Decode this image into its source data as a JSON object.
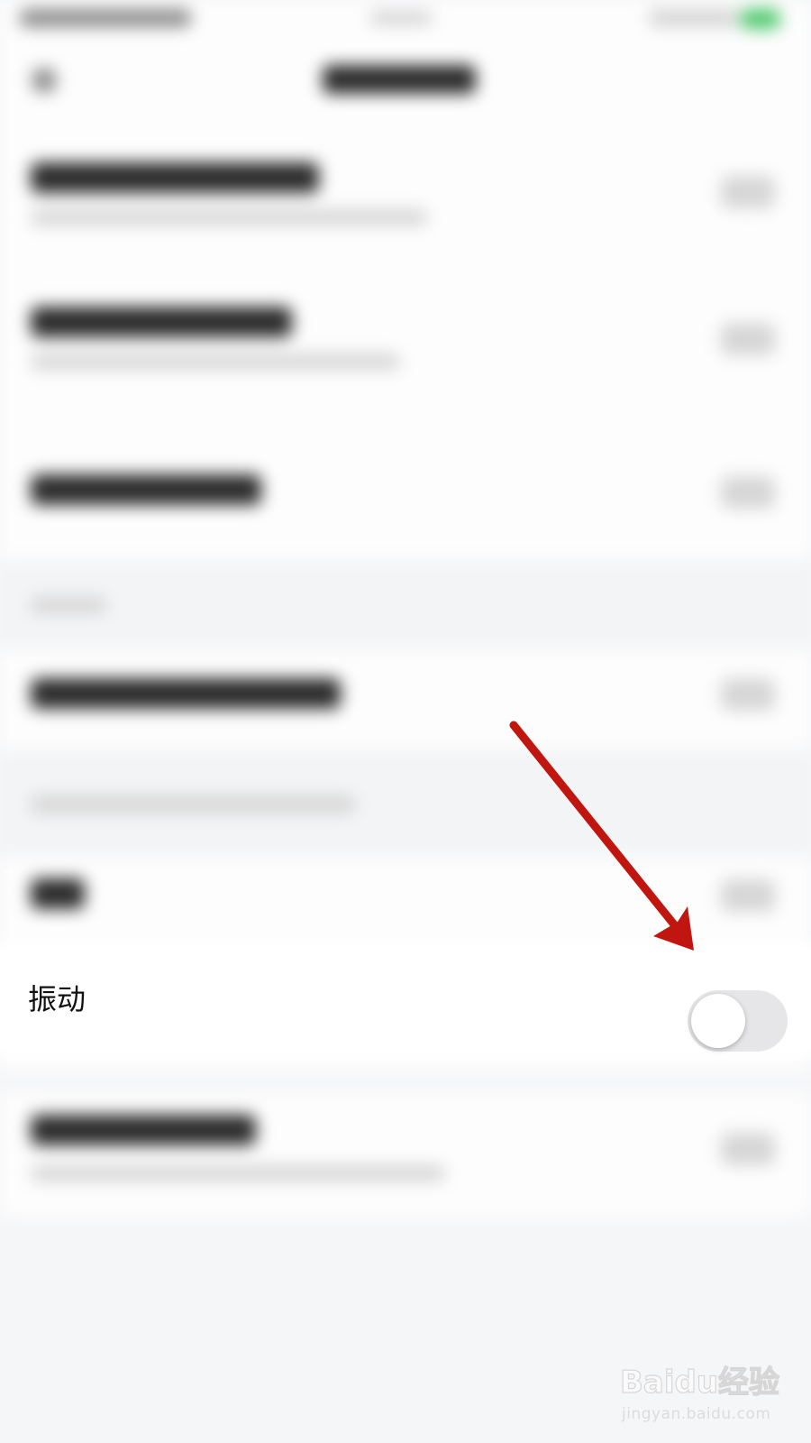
{
  "settings": {
    "vibration_label": "振动",
    "vibration_enabled": false
  },
  "watermark": {
    "logo_text": "Baidu经验",
    "url": "jingyan.baidu.com"
  },
  "colors": {
    "arrow": "#c0160f",
    "toggle_off": "#e6e6e9",
    "page_background": "#f5f6f8"
  }
}
